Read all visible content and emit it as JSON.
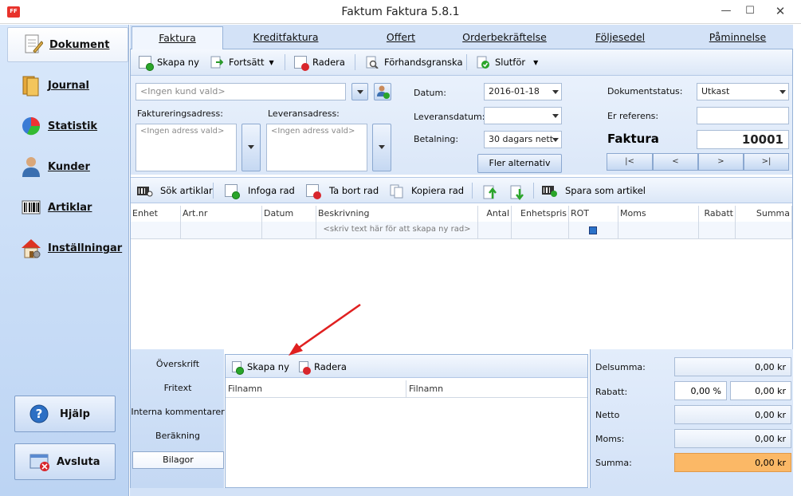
{
  "window": {
    "title": "Faktum Faktura 5.8.1",
    "icon": "FF",
    "minimize": "—",
    "maximize": "☐",
    "close": "✕"
  },
  "sidebar": {
    "items": [
      {
        "label": "Dokument",
        "icon": "document-icon",
        "active": true
      },
      {
        "label": "Journal",
        "icon": "journal-icon"
      },
      {
        "label": "Statistik",
        "icon": "pie-chart-icon"
      },
      {
        "label": "Kunder",
        "icon": "person-icon"
      },
      {
        "label": "Artiklar",
        "icon": "barcode-icon"
      },
      {
        "label": "Inställningar",
        "icon": "house-icon"
      }
    ],
    "help_label": "Hjälp",
    "quit_label": "Avsluta"
  },
  "tabs": [
    "Faktura",
    "Kreditfaktura",
    "Offert",
    "Orderbekräftelse",
    "Följesedel",
    "Påminnelse"
  ],
  "doc_toolbar": {
    "new": "Skapa ny",
    "continue": "Fortsätt",
    "delete": "Radera",
    "preview": "Förhandsgranska",
    "finish": "Slutför"
  },
  "customer": {
    "placeholder": "<Ingen kund vald>",
    "billing_label": "Faktureringsadress:",
    "delivery_label": "Leveransadress:",
    "billing_value": "<Ingen adress vald>",
    "delivery_value": "<Ingen adress vald>"
  },
  "dates": {
    "date_label": "Datum:",
    "date_value": "2016-01-18",
    "delivery_date_label": "Leveransdatum:",
    "delivery_date_value": "",
    "payment_label": "Betalning:",
    "payment_value": "30 dagars nett",
    "more_button": "Fler alternativ"
  },
  "status": {
    "doc_status_label": "Dokumentstatus:",
    "doc_status_value": "Utkast",
    "reference_label": "Er referens:",
    "reference_value": "",
    "doc_type": "Faktura",
    "doc_number": "10001",
    "nav": [
      "|<",
      "<",
      ">",
      ">|"
    ]
  },
  "row_toolbar": {
    "search": "Sök artiklar",
    "insert": "Infoga rad",
    "remove": "Ta bort rad",
    "copy": "Kopiera rad",
    "save": "Spara som artikel"
  },
  "grid": {
    "columns": [
      "Enhet",
      "Art.nr",
      "Datum",
      "Beskrivning",
      "Antal",
      "Enhetspris",
      "ROT",
      "Moms",
      "Rabatt",
      "Summa"
    ],
    "new_row_hint": "<skriv text här för att skapa ny rad>"
  },
  "bottom_nav": [
    "Överskrift",
    "Fritext",
    "Interna kommentarer",
    "Beräkning",
    "Bilagor"
  ],
  "attachments": {
    "new": "Skapa ny",
    "delete": "Radera",
    "columns": [
      "Filnamn",
      "Filnamn"
    ]
  },
  "summary": {
    "subtotal_label": "Delsumma:",
    "subtotal": "0,00 kr",
    "discount_label": "Rabatt:",
    "discount_pct": "0,00 %",
    "discount": "0,00 kr",
    "net_label": "Netto",
    "net": "0,00 kr",
    "vat_label": "Moms:",
    "vat": "0,00 kr",
    "total_label": "Summa:",
    "total": "0,00 kr",
    "total_color": "#fbb866"
  }
}
